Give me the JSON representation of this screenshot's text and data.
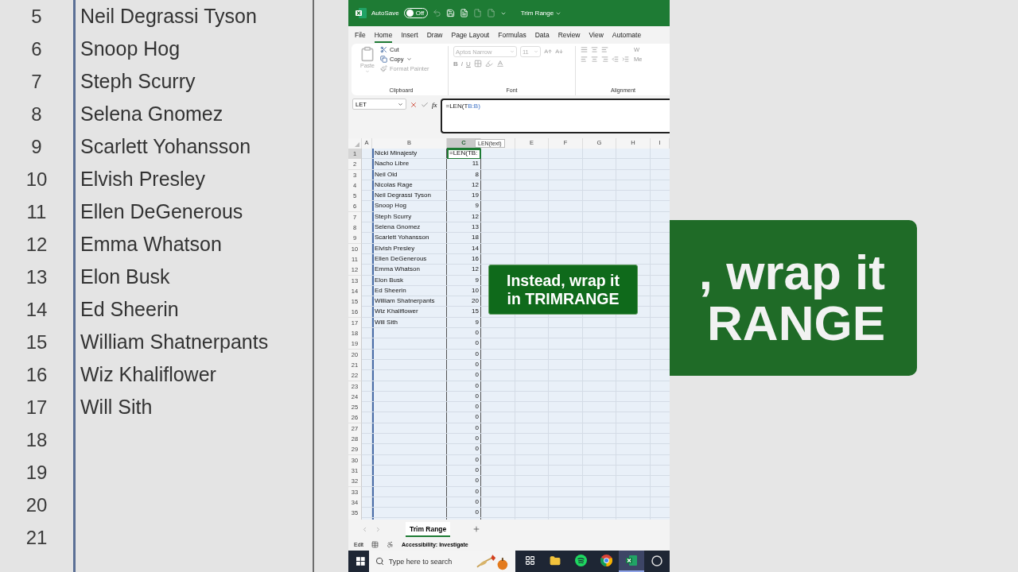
{
  "background_left": {
    "rows": [
      {
        "number": "5",
        "name": "Neil Degrassi Tyson"
      },
      {
        "number": "6",
        "name": "Snoop Hog"
      },
      {
        "number": "7",
        "name": "Steph Scurry"
      },
      {
        "number": "8",
        "name": "Selena Gnomez"
      },
      {
        "number": "9",
        "name": "Scarlett Yohansson"
      },
      {
        "number": "10",
        "name": "Elvish Presley"
      },
      {
        "number": "11",
        "name": "Ellen DeGenerous"
      },
      {
        "number": "12",
        "name": "Emma Whatson"
      },
      {
        "number": "13",
        "name": "Elon Busk"
      },
      {
        "number": "14",
        "name": "Ed Sheerin"
      },
      {
        "number": "15",
        "name": "William Shatnerpants"
      },
      {
        "number": "16",
        "name": "Wiz Khaliflower"
      },
      {
        "number": "17",
        "name": "Will Sith"
      },
      {
        "number": "18"
      },
      {
        "number": "19"
      },
      {
        "number": "20"
      },
      {
        "number": "21"
      }
    ]
  },
  "background_right": {
    "caption_lines": [
      ", wrap it",
      "RANGE"
    ]
  },
  "title_bar": {
    "autosave_label": "AutoSave",
    "autosave": {
      "on": false,
      "label": "Off"
    },
    "file_name": "Trim Range"
  },
  "ribbon_tabs": [
    {
      "label": "File",
      "selected": false
    },
    {
      "label": "Home",
      "selected": true
    },
    {
      "label": "Insert",
      "selected": false
    },
    {
      "label": "Draw",
      "selected": false
    },
    {
      "label": "Page Layout",
      "selected": false
    },
    {
      "label": "Formulas",
      "selected": false
    },
    {
      "label": "Data",
      "selected": false
    },
    {
      "label": "Review",
      "selected": false
    },
    {
      "label": "View",
      "selected": false
    },
    {
      "label": "Automate",
      "selected": false
    }
  ],
  "ribbon": {
    "clipboard": {
      "label": "Clipboard",
      "paste": {
        "label": "Paste",
        "disabled": true
      },
      "items": [
        {
          "kind": "cut",
          "label": "Cut",
          "disabled": false
        },
        {
          "kind": "copy",
          "label": "Copy",
          "disabled": false
        },
        {
          "kind": "format-painter",
          "label": "Format Painter",
          "disabled": true
        }
      ]
    },
    "font": {
      "label": "Font",
      "font_name": "Aptos Narrow",
      "font_size": "11",
      "disabled": true,
      "styles": [
        "B",
        "I",
        "U"
      ]
    },
    "alignment": {
      "label": "Alignment",
      "wrap_label": "W",
      "merge_label": "Me"
    }
  },
  "formula_bar": {
    "name_box": "LET",
    "function_button": "fx",
    "formula": [
      {
        "text": "=LEN(T",
        "reference": false
      },
      {
        "text": "B:B)",
        "reference": true
      }
    ]
  },
  "tooltip": "LEN(text)",
  "columns": [
    {
      "label": "A",
      "selected": false
    },
    {
      "label": "B",
      "selected": false
    },
    {
      "label": "C",
      "selected": true
    },
    {
      "selected": false
    },
    {
      "label": "E",
      "selected": false
    },
    {
      "label": "F",
      "selected": false
    },
    {
      "label": "G",
      "selected": false
    },
    {
      "label": "H",
      "selected": false
    },
    {
      "label": "I",
      "selected": false
    }
  ],
  "rows": [
    {
      "number": "1",
      "b": "Nicki Minajesty",
      "c": "=LEN(TB:",
      "active": true
    },
    {
      "number": "2",
      "b": "Nacho Libre",
      "c": "11",
      "active": false
    },
    {
      "number": "3",
      "b": "Neil Old",
      "c": "8",
      "active": false
    },
    {
      "number": "4",
      "b": "Nicolas Rage",
      "c": "12",
      "active": false
    },
    {
      "number": "5",
      "b": "Neil Degrassi Tyson",
      "c": "19",
      "active": false
    },
    {
      "number": "6",
      "b": "Snoop Hog",
      "c": "9",
      "active": false
    },
    {
      "number": "7",
      "b": "Steph Scurry",
      "c": "12",
      "active": false
    },
    {
      "number": "8",
      "b": "Selena Gnomez",
      "c": "13",
      "active": false
    },
    {
      "number": "9",
      "b": "Scarlett Yohansson",
      "c": "18",
      "active": false
    },
    {
      "number": "10",
      "b": "Elvish Presley",
      "c": "14",
      "active": false
    },
    {
      "number": "11",
      "b": "Ellen DeGenerous",
      "c": "16",
      "active": false
    },
    {
      "number": "12",
      "b": "Emma Whatson",
      "c": "12",
      "active": false
    },
    {
      "number": "13",
      "b": "Elon Busk",
      "c": "9",
      "active": false
    },
    {
      "number": "14",
      "b": "Ed Sheerin",
      "c": "10",
      "active": false
    },
    {
      "number": "15",
      "b": "William Shatnerpants",
      "c": "20",
      "active": false
    },
    {
      "number": "16",
      "b": "Wiz Khaliflower",
      "c": "15",
      "active": false
    },
    {
      "number": "17",
      "b": "Will Sith",
      "c": "9",
      "active": false
    },
    {
      "number": "18",
      "c": "0",
      "active": false
    },
    {
      "number": "19",
      "c": "0",
      "active": false
    },
    {
      "number": "20",
      "c": "0",
      "active": false
    },
    {
      "number": "21",
      "c": "0",
      "active": false
    },
    {
      "number": "22",
      "c": "0",
      "active": false
    },
    {
      "number": "23",
      "c": "0",
      "active": false
    },
    {
      "number": "24",
      "c": "0",
      "active": false
    },
    {
      "number": "25",
      "c": "0",
      "active": false
    },
    {
      "number": "26",
      "c": "0",
      "active": false
    },
    {
      "number": "27",
      "c": "0",
      "active": false
    },
    {
      "number": "28",
      "c": "0",
      "active": false
    },
    {
      "number": "29",
      "c": "0",
      "active": false
    },
    {
      "number": "30",
      "c": "0",
      "active": false
    },
    {
      "number": "31",
      "c": "0",
      "active": false
    },
    {
      "number": "32",
      "c": "0",
      "active": false
    },
    {
      "number": "33",
      "c": "0",
      "active": false
    },
    {
      "number": "34",
      "c": "0",
      "active": false
    },
    {
      "number": "35",
      "c": "0",
      "active": false
    }
  ],
  "caption_lines": [
    "Instead, wrap it",
    "in TRIMRANGE"
  ],
  "sheet_tabs": [
    {
      "label": "Trim Range",
      "selected": true
    }
  ],
  "status_bar": {
    "mode": "Edit",
    "accessibility": "Accessibility: Investigate"
  },
  "taskbar": {
    "search_placeholder": "Type here to search",
    "apps": [
      {
        "kind": "task-view",
        "selected": false
      },
      {
        "kind": "folder",
        "selected": false
      },
      {
        "kind": "spotify",
        "selected": false
      },
      {
        "kind": "chrome",
        "selected": false
      },
      {
        "kind": "excel",
        "selected": true
      },
      {
        "kind": "other",
        "selected": false
      }
    ]
  }
}
